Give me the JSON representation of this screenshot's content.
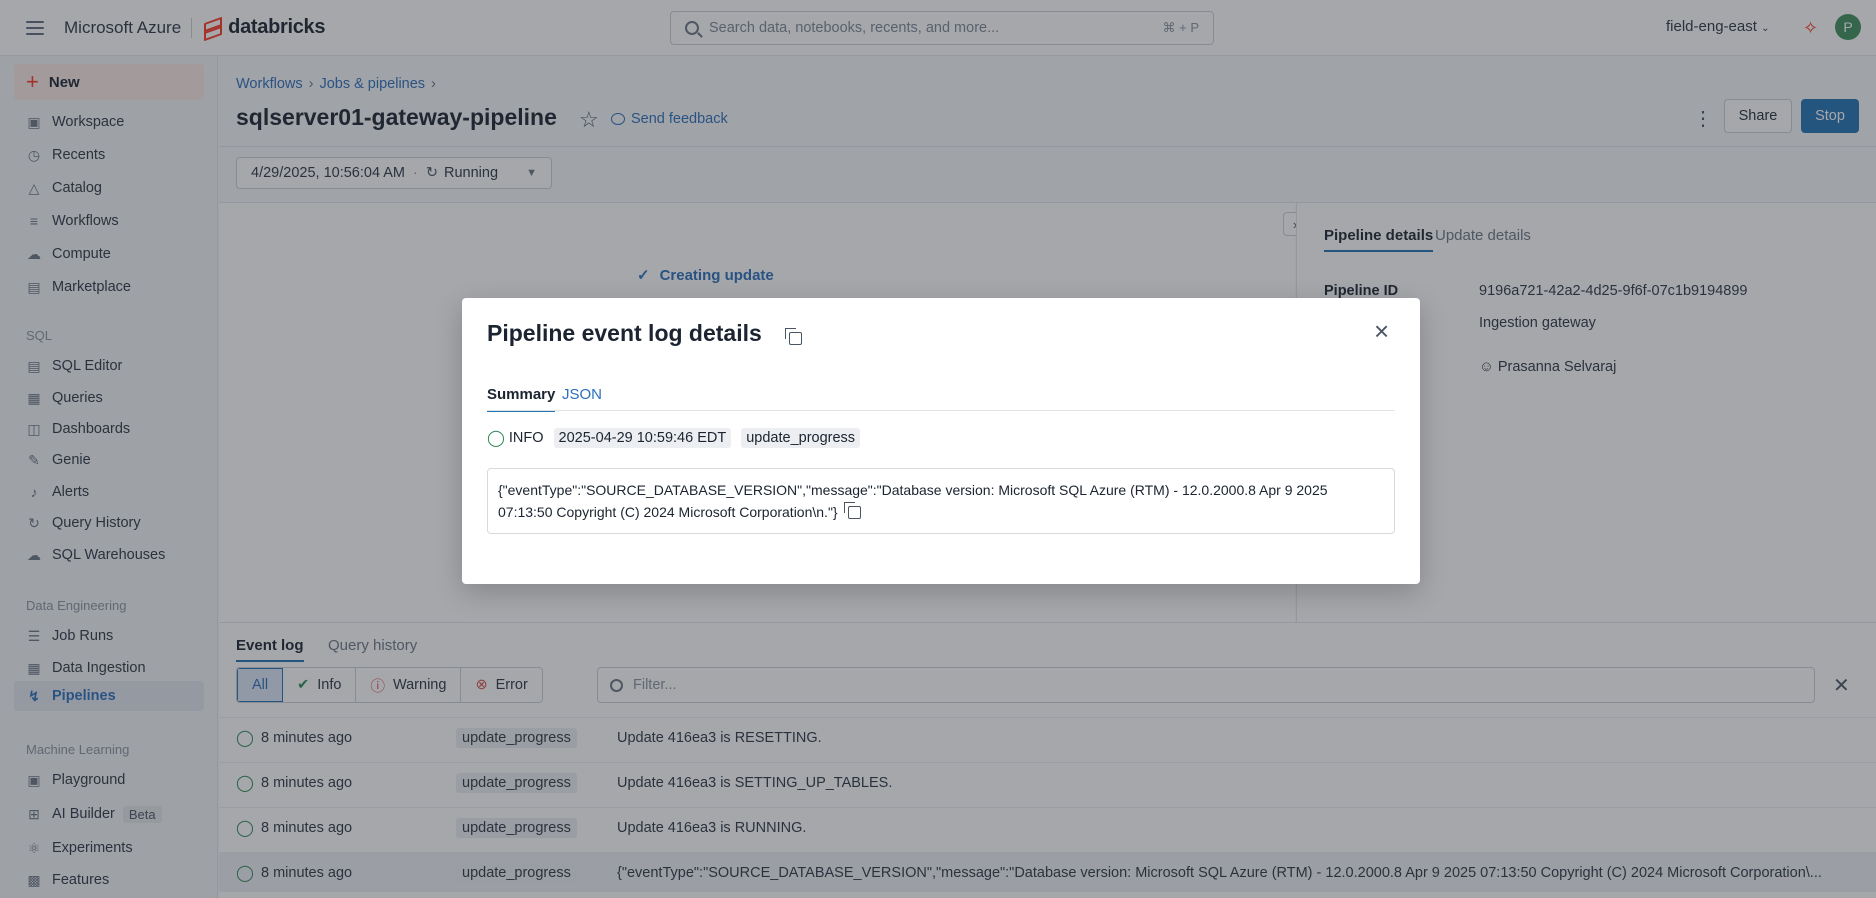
{
  "topbar": {
    "brand_ms": "Microsoft Azure",
    "brand_db": "databricks",
    "search_placeholder": "Search data, notebooks, recents, and more...",
    "search_shortcut": "⌘ + P",
    "workspace": "field-eng-east",
    "avatar_initial": "P"
  },
  "sidebar": {
    "new_label": "New",
    "items": [
      {
        "label": "Workspace",
        "icon": "folder-icon"
      },
      {
        "label": "Recents",
        "icon": "clock-icon"
      },
      {
        "label": "Catalog",
        "icon": "catalog-icon"
      },
      {
        "label": "Workflows",
        "icon": "workflows-icon"
      },
      {
        "label": "Compute",
        "icon": "cloud-icon"
      },
      {
        "label": "Marketplace",
        "icon": "store-icon"
      }
    ],
    "section_sql": "SQL",
    "sql_items": [
      {
        "label": "SQL Editor"
      },
      {
        "label": "Queries"
      },
      {
        "label": "Dashboards"
      },
      {
        "label": "Genie"
      },
      {
        "label": "Alerts"
      },
      {
        "label": "Query History"
      },
      {
        "label": "SQL Warehouses"
      }
    ],
    "section_de": "Data Engineering",
    "de_items": [
      {
        "label": "Job Runs"
      },
      {
        "label": "Data Ingestion"
      },
      {
        "label": "Pipelines"
      }
    ],
    "section_ml": "Machine Learning",
    "ml_items": [
      {
        "label": "Playground"
      },
      {
        "label": "AI Builder",
        "badge": "Beta"
      },
      {
        "label": "Experiments"
      },
      {
        "label": "Features"
      }
    ]
  },
  "header": {
    "breadcrumb": [
      "Workflows",
      "Jobs & pipelines"
    ],
    "title": "sqlserver01-gateway-pipeline",
    "feedback": "Send feedback",
    "share": "Share",
    "stop": "Stop"
  },
  "run": {
    "timestamp": "4/29/2025, 10:56:04 AM",
    "status": "Running"
  },
  "graph": {
    "step": "Creating update"
  },
  "details": {
    "tabs": [
      "Pipeline details",
      "Update details"
    ],
    "pipeline_id_label": "Pipeline ID",
    "pipeline_id": "9196a721-42a2-4d25-9f6f-07c1b9194899",
    "type_value": "Ingestion gateway",
    "owner": "Prasanna Selvaraj"
  },
  "bottom": {
    "tabs": [
      "Event log",
      "Query history"
    ],
    "filters": [
      "All",
      "Info",
      "Warning",
      "Error"
    ],
    "filter_placeholder": "Filter...",
    "rows": [
      {
        "time": "8 minutes ago",
        "type": "update_progress",
        "msg": "Update 416ea3 is RESETTING."
      },
      {
        "time": "8 minutes ago",
        "type": "update_progress",
        "msg": "Update 416ea3 is SETTING_UP_TABLES."
      },
      {
        "time": "8 minutes ago",
        "type": "update_progress",
        "msg": "Update 416ea3 is RUNNING."
      },
      {
        "time": "8 minutes ago",
        "type": "update_progress",
        "msg": "{\"eventType\":\"SOURCE_DATABASE_VERSION\",\"message\":\"Database version: Microsoft SQL Azure (RTM) - 12.0.2000.8 Apr 9 2025 07:13:50 Copyright (C) 2024 Microsoft Corporation\\..."
      }
    ]
  },
  "modal": {
    "title": "Pipeline event log details",
    "tabs": [
      "Summary",
      "JSON"
    ],
    "level": "INFO",
    "timestamp": "2025-04-29 10:59:46 EDT",
    "event_type": "update_progress",
    "json_line1": "{\"eventType\":\"SOURCE_DATABASE_VERSION\",\"message\":\"Database version: Microsoft SQL Azure (RTM) - 12.0.2000.8 Apr 9 2025",
    "json_line2": "07:13:50 Copyright (C) 2024 Microsoft Corporation\\n.\"}"
  }
}
